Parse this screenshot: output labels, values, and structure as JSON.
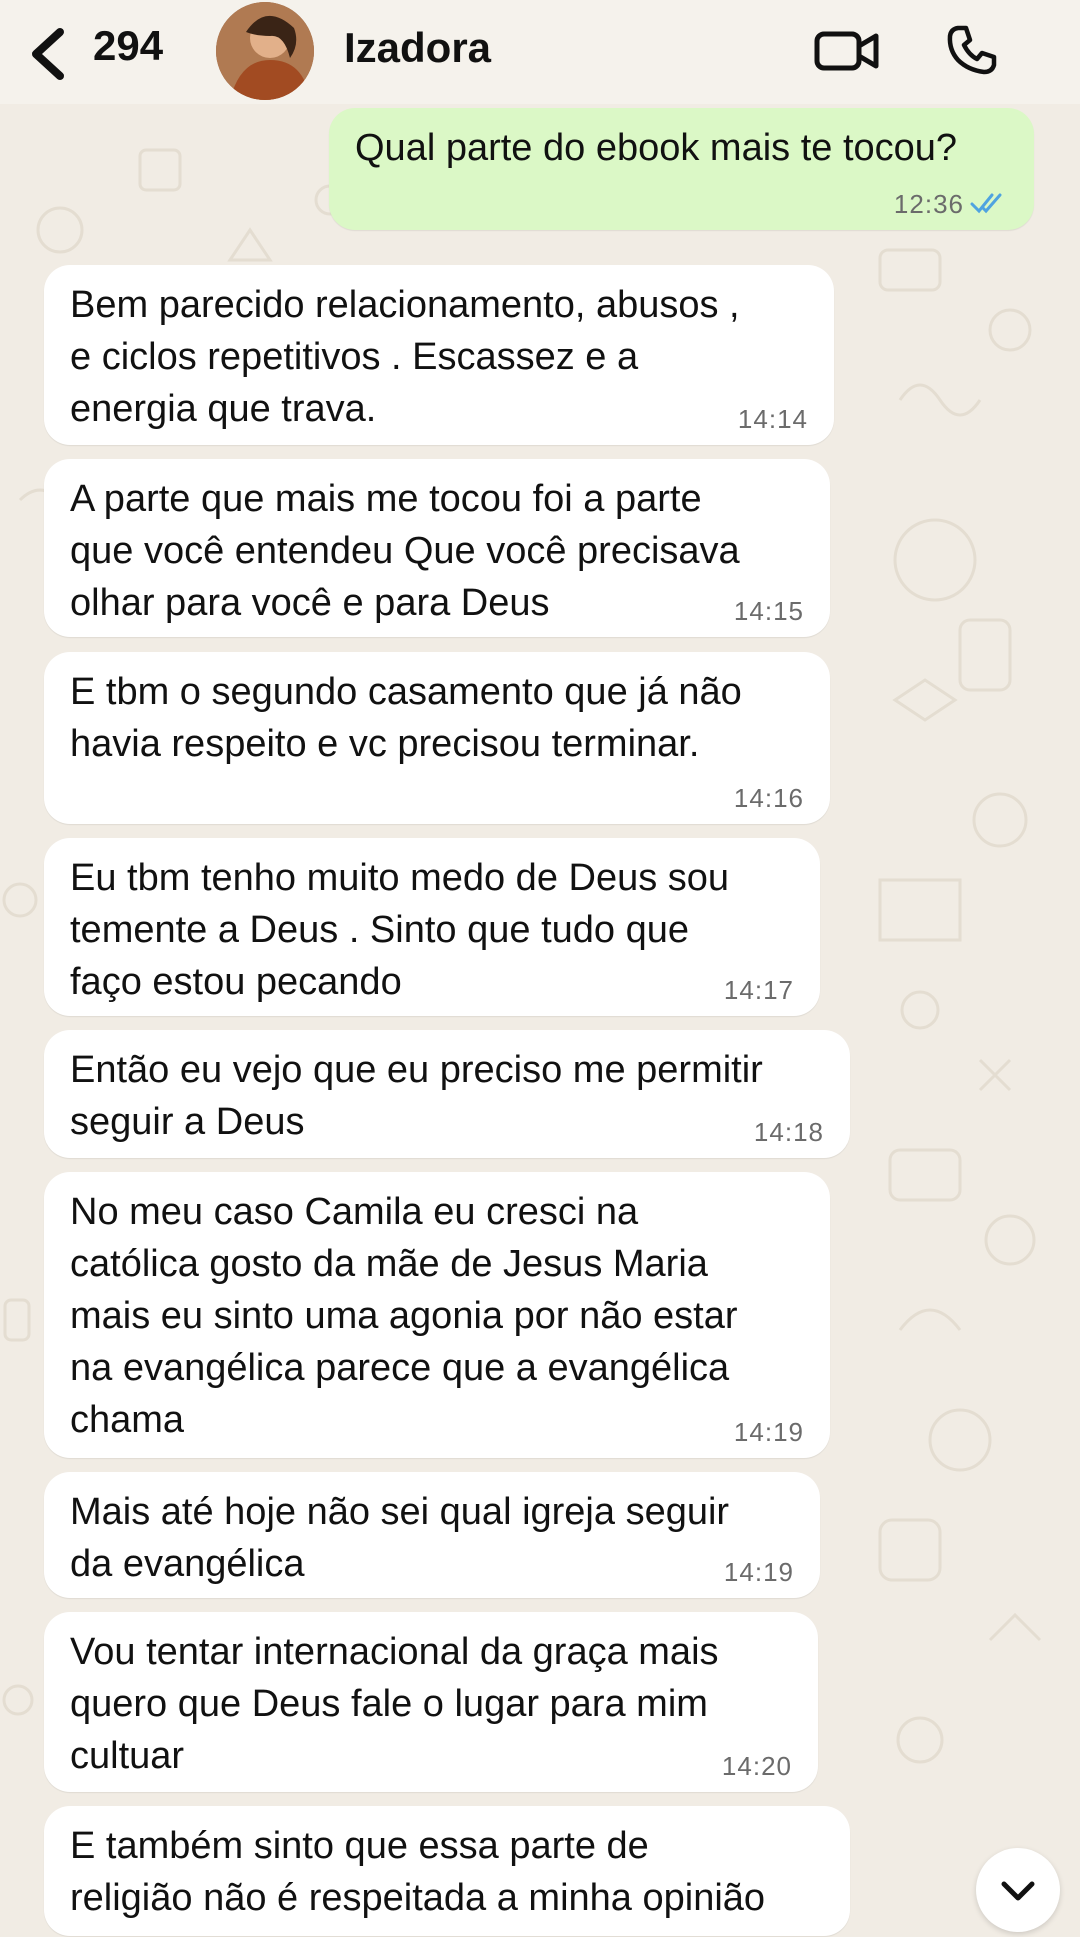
{
  "header": {
    "back_count": "294",
    "contact_name": "Izadora"
  },
  "messages": [
    {
      "direction": "outgoing",
      "text": "Qual parte do ebook mais te tocou?",
      "time": "12:36",
      "status": "read"
    },
    {
      "direction": "incoming",
      "text": "Bem parecido relacionamento, abusos ,\ne ciclos repetitivos . Escassez e   a\nenergia que trava.",
      "time": "14:14"
    },
    {
      "direction": "incoming",
      "text": "A parte que mais me tocou foi a parte\nque você entendeu Que você precisava\nolhar para você e para Deus",
      "time": "14:15"
    },
    {
      "direction": "incoming",
      "text": "E tbm o segundo casamento que já não\nhavia respeito e vc precisou terminar.",
      "time": "14:16"
    },
    {
      "direction": "incoming",
      "text": "Eu tbm tenho muito medo de Deus sou\ntemente a Deus . Sinto que tudo que\nfaço estou pecando",
      "time": "14:17"
    },
    {
      "direction": "incoming",
      "text": "Então eu vejo que eu preciso me permitir\nseguir a Deus",
      "time": "14:18"
    },
    {
      "direction": "incoming",
      "text": "No meu caso Camila eu cresci na\ncatólica gosto da mãe de Jesus Maria\nmais eu sinto uma agonia por não estar\nna evangélica parece que a evangélica\nchama",
      "time": "14:19"
    },
    {
      "direction": "incoming",
      "text": "Mais até hoje não sei qual igreja seguir\nda evangélica",
      "time": "14:19"
    },
    {
      "direction": "incoming",
      "text": "Vou tentar internacional da graça mais\nquero que Deus fale o lugar para mim\ncultuar",
      "time": "14:20"
    },
    {
      "direction": "incoming",
      "text": "E também sinto que essa parte de\nreligião não é respeitada a minha opinião",
      "time": ""
    }
  ],
  "colors": {
    "outgoing_bubble": "#dbf8c6",
    "incoming_bubble": "#ffffff",
    "background": "#f1ece4",
    "read_tick": "#4fa3e0"
  },
  "icons": [
    "back-chevron-icon",
    "video-camera-icon",
    "phone-icon",
    "double-check-icon",
    "chevron-down-icon"
  ]
}
